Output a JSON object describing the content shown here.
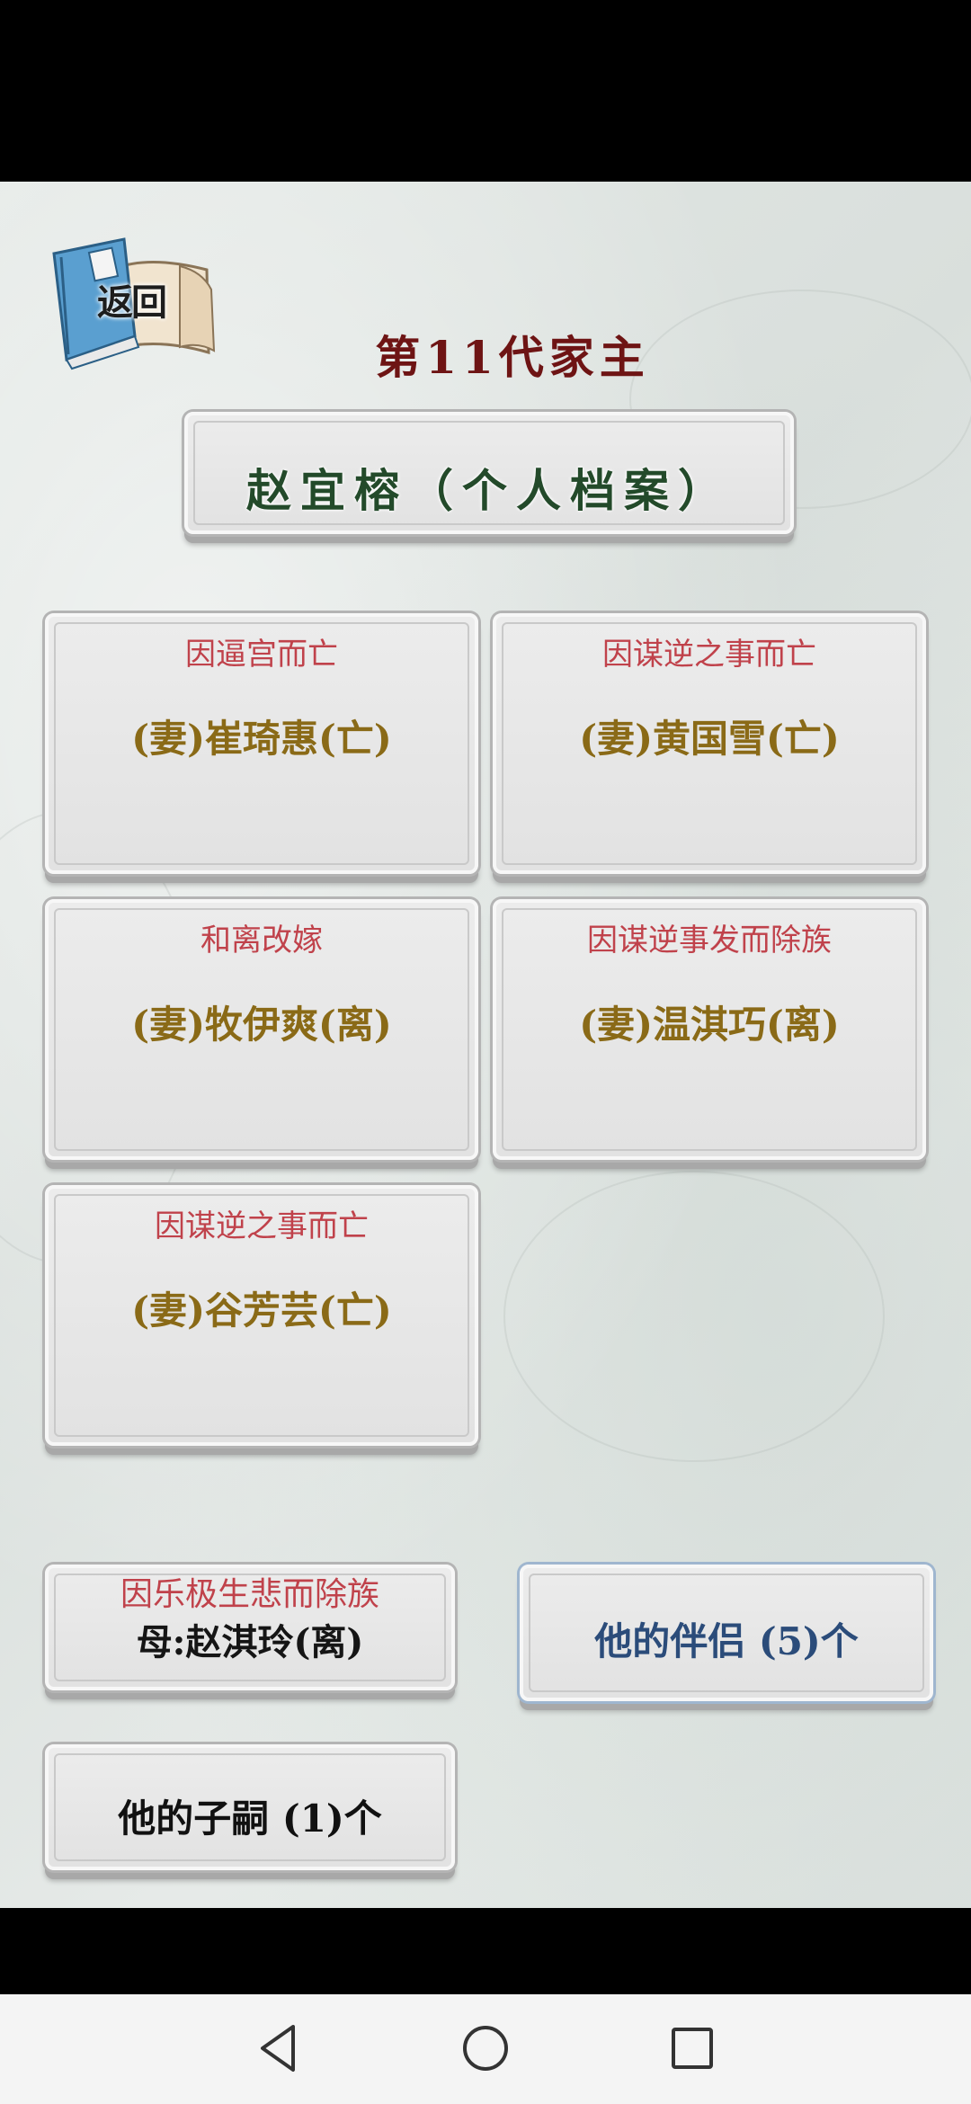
{
  "back": {
    "label": "返回"
  },
  "generation_title": "第11代家主",
  "profile_title": "赵宜榕（个人档案）",
  "spouses": [
    {
      "status": "因逼宫而亡",
      "name": "(妻)崔琦惠(亡)"
    },
    {
      "status": "因谋逆之事而亡",
      "name": "(妻)黄国雪(亡)"
    },
    {
      "status": "和离改嫁",
      "name": "(妻)牧伊爽(离)"
    },
    {
      "status": "因谋逆事发而除族",
      "name": "(妻)温淇巧(离)"
    },
    {
      "status": "因谋逆之事而亡",
      "name": "(妻)谷芳芸(亡)"
    }
  ],
  "mother": {
    "status": "因乐极生悲而除族",
    "name": "母:赵淇玲(离)"
  },
  "partners_button": "他的伴侣 (5)个",
  "children_button": "他的子嗣 (1)个",
  "colors": {
    "status_red": "#c0424b",
    "name_gold": "#8a6a17",
    "title_maroon": "#6e1414",
    "profile_green": "#234a2a",
    "partners_blue": "#2b4c7a"
  },
  "icons": [
    "book-scroll-icon",
    "back-nav-icon",
    "home-nav-icon",
    "recents-nav-icon"
  ]
}
